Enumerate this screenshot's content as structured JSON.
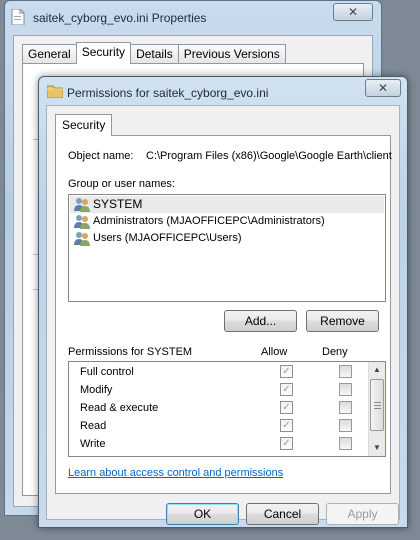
{
  "back_window": {
    "title": "saitek_cyborg_evo.ini Properties",
    "close_label": "✕",
    "tabs": [
      {
        "label": "General"
      },
      {
        "label": "Security"
      },
      {
        "label": "Details"
      },
      {
        "label": "Previous Versions"
      }
    ]
  },
  "dialog": {
    "title": "Permissions for saitek_cyborg_evo.ini",
    "close_label": "✕",
    "tab": "Security",
    "object_name_label": "Object name:",
    "object_name_value": "C:\\Program Files (x86)\\Google\\Google Earth\\client",
    "group_label": "Group or user names:",
    "users": [
      {
        "name": "SYSTEM",
        "selected": true
      },
      {
        "name": "Administrators (MJAOFFICEPC\\Administrators)",
        "selected": false
      },
      {
        "name": "Users (MJAOFFICEPC\\Users)",
        "selected": false
      }
    ],
    "add_button": "Add...",
    "remove_button": "Remove",
    "permissions_label": "Permissions for SYSTEM",
    "allow_label": "Allow",
    "deny_label": "Deny",
    "permissions": [
      {
        "name": "Full control",
        "allow": true,
        "deny": false
      },
      {
        "name": "Modify",
        "allow": true,
        "deny": false
      },
      {
        "name": "Read & execute",
        "allow": true,
        "deny": false
      },
      {
        "name": "Read",
        "allow": true,
        "deny": false
      },
      {
        "name": "Write",
        "allow": true,
        "deny": false
      }
    ],
    "learn_link": "Learn about access control and permissions",
    "ok_button": "OK",
    "cancel_button": "Cancel",
    "apply_button": "Apply"
  }
}
